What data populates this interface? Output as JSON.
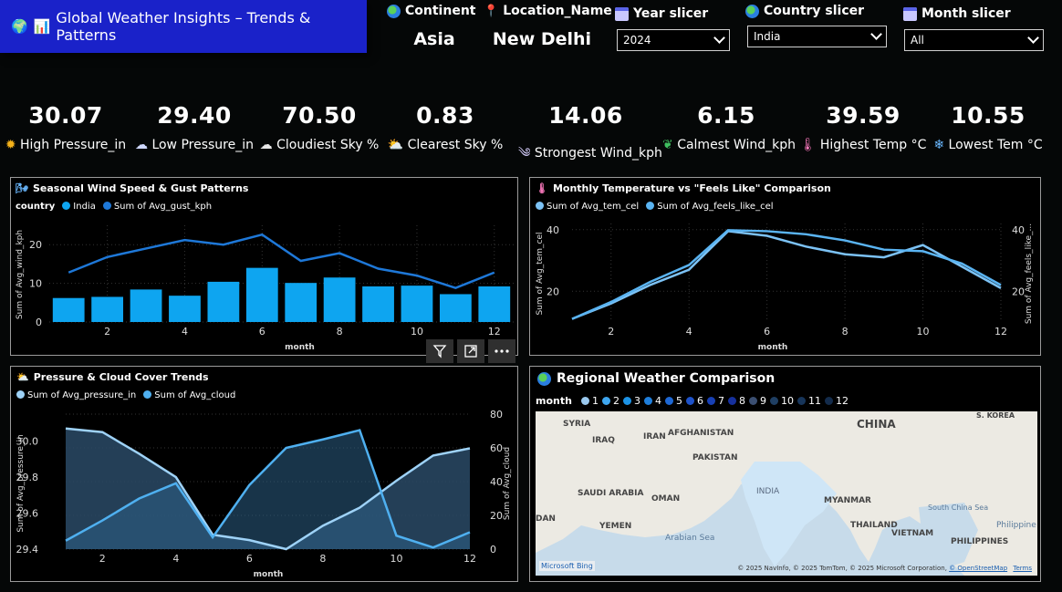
{
  "title": "Global Weather Insights – Trends & Patterns",
  "header": {
    "continent_label": "Continent",
    "continent_value": "Asia",
    "location_label": "Location_Name",
    "location_value": "New Delhi",
    "year_label": "Year slicer",
    "year_value": "2024",
    "country_label": "Country slicer",
    "country_value": "India",
    "month_label": "Month slicer",
    "month_value": "All"
  },
  "kpis": [
    {
      "value": "30.07",
      "label": "High Pressure_in",
      "icon": "sun-icon"
    },
    {
      "value": "29.40",
      "label": "Low Pressure_in",
      "icon": "rain-cloud-icon"
    },
    {
      "value": "70.50",
      "label": "Cloudiest Sky %",
      "icon": "cloud-icon"
    },
    {
      "value": "0.83",
      "label": "Clearest Sky %",
      "icon": "sun-cloud-icon"
    },
    {
      "value": "14.06",
      "label": "Strongest Wind_kph",
      "icon": "wind-icon"
    },
    {
      "value": "6.15",
      "label": "Calmest Wind_kph",
      "icon": "leaf-icon"
    },
    {
      "value": "39.59",
      "label": "Highest Temp °C",
      "icon": "thermometer-icon"
    },
    {
      "value": "10.55",
      "label": "Lowest Tem °C",
      "icon": "snowflake-icon"
    }
  ],
  "wind_panel": {
    "title": "Seasonal Wind Speed & Gust Patterns",
    "legend_field": "country",
    "legend_items": [
      "India",
      "Sum of Avg_gust_kph"
    ],
    "ylabel": "Sum of Avg_wind_kph",
    "xlabel": "month",
    "yticks": [
      "20",
      "10",
      "0"
    ],
    "xticks": [
      "2",
      "4",
      "6",
      "8",
      "10",
      "12"
    ]
  },
  "temp_panel": {
    "title": "Monthly Temperature vs \"Feels Like\" Comparison",
    "legend_items": [
      "Sum of Avg_tem_cel",
      "Sum of Avg_feels_like_cel"
    ],
    "ylabel_left": "Sum of Avg_tem_cel",
    "ylabel_right": "Sum of Avg_feels_like_...",
    "xlabel": "month",
    "yticks_left": [
      "40",
      "20"
    ],
    "yticks_right": [
      "40",
      "20"
    ],
    "xticks": [
      "2",
      "4",
      "6",
      "8",
      "10",
      "12"
    ]
  },
  "pressure_panel": {
    "title": "Pressure & Cloud Cover Trends",
    "legend_items": [
      "Sum of Avg_pressure_in",
      "Sum of Avg_cloud"
    ],
    "ylabel_left": "Sum of Avg_pressure_in",
    "ylabel_right": "Sum of Avg_cloud",
    "xlabel": "month",
    "yticks_left": [
      "30.0",
      "29.8",
      "29.6",
      "29.4"
    ],
    "yticks_right": [
      "80",
      "60",
      "40",
      "20",
      "0"
    ],
    "xticks": [
      "2",
      "4",
      "6",
      "8",
      "10",
      "12"
    ]
  },
  "map_panel": {
    "title": "Regional Weather Comparison",
    "legend_field": "month",
    "legend_items": [
      "1",
      "2",
      "3",
      "4",
      "5",
      "6",
      "7",
      "8",
      "9",
      "10",
      "11",
      "12"
    ],
    "labels": {
      "syria": "SYRIA",
      "iraq": "IRAQ",
      "iran": "IRAN",
      "afghanistan": "AFGHANISTAN",
      "pakistan": "PAKISTAN",
      "saudi": "SAUDI ARABIA",
      "oman": "OMAN",
      "yemen": "YEMEN",
      "india": "INDIA",
      "china": "CHINA",
      "myanmar": "MYANMAR",
      "thailand": "THAILAND",
      "vietnam": "VIETNAM",
      "philippines": "PHILIPPINES",
      "skorea": "S. KOREA",
      "arabian_sea": "Arabian Sea",
      "south_china_sea": "South China Sea",
      "philippine": "Philippine",
      "dan": "DAN"
    },
    "attribution": "© 2025 NavInfo, © 2025 TomTom, © 2025 Microsoft Corporation, ",
    "osm_link": "© OpenStreetMap",
    "terms_link": "Terms",
    "bing": "Microsoft Bing"
  },
  "colors": {
    "accent_blue": "#0ea5f0",
    "line_dark_blue": "#1e78d8",
    "light_blue": "#7cc2f5",
    "title_banner": "#1a22c9",
    "month_colors": [
      "#9ac9ef",
      "#3ea6ef",
      "#1c93e6",
      "#1f7fdc",
      "#1e68d4",
      "#1e52c9",
      "#1840b4",
      "#16309d",
      "#3b4f72",
      "#1f3f63",
      "#17355a",
      "#132b4b"
    ]
  },
  "chart_data": [
    {
      "type": "bar",
      "name": "wind",
      "x": [
        1,
        2,
        3,
        4,
        5,
        6,
        7,
        8,
        9,
        10,
        11,
        12
      ],
      "series": [
        {
          "name": "India",
          "kind": "bar",
          "values": [
            6.2,
            6.5,
            8.4,
            6.8,
            10.4,
            14.0,
            10.1,
            11.5,
            9.2,
            9.4,
            7.2,
            9.2
          ]
        },
        {
          "name": "Sum of Avg_gust_kph",
          "kind": "line",
          "values": [
            12.8,
            16.8,
            19.0,
            21.2,
            20.0,
            22.6,
            15.8,
            17.8,
            13.8,
            12.0,
            8.8,
            12.8
          ]
        }
      ],
      "ylim": [
        0,
        25
      ],
      "xlabel": "month",
      "ylabel": "Sum of Avg_wind_kph"
    },
    {
      "type": "line",
      "name": "temperature",
      "x": [
        1,
        2,
        3,
        4,
        5,
        6,
        7,
        8,
        9,
        10,
        11,
        12
      ],
      "series": [
        {
          "name": "Sum of Avg_tem_cel",
          "values": [
            11,
            16,
            22,
            27,
            39.5,
            38,
            34.5,
            32,
            31,
            35,
            28,
            21
          ]
        },
        {
          "name": "Sum of Avg_feels_like_cel",
          "values": [
            11,
            16.5,
            23,
            28.5,
            39.8,
            39.5,
            38.5,
            36.5,
            33.5,
            33,
            29,
            22
          ]
        }
      ],
      "ylim": [
        10,
        42
      ],
      "xlabel": "month"
    },
    {
      "type": "area",
      "name": "pressure_cloud",
      "x": [
        1,
        2,
        3,
        4,
        5,
        6,
        7,
        8,
        9,
        10,
        11,
        12
      ],
      "series": [
        {
          "name": "Sum of Avg_pressure_in",
          "axis": "left",
          "values": [
            30.07,
            30.05,
            29.93,
            29.8,
            29.48,
            29.45,
            29.4,
            29.53,
            29.63,
            29.78,
            29.92,
            29.96
          ]
        },
        {
          "name": "Sum of Avg_cloud",
          "axis": "right",
          "values": [
            5,
            17,
            30,
            39,
            7,
            38,
            60,
            65,
            70.5,
            8,
            1,
            10
          ]
        }
      ],
      "ylim_left": [
        29.4,
        30.15
      ],
      "ylim_right": [
        0,
        80
      ],
      "xlabel": "month"
    }
  ]
}
